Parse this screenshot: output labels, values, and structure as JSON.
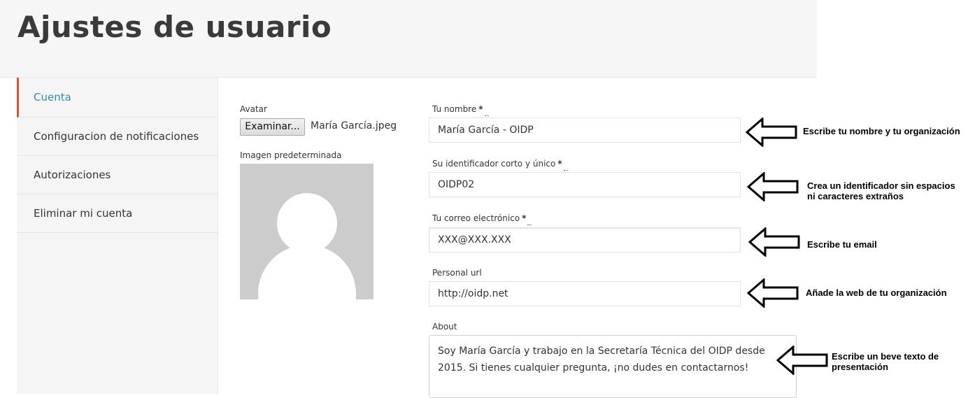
{
  "page": {
    "title": "Ajustes de usuario"
  },
  "sidebar": {
    "items": [
      {
        "label": "Cuenta",
        "active": true
      },
      {
        "label": "Configuracion de notificaciones",
        "active": false
      },
      {
        "label": "Autorizaciones",
        "active": false
      },
      {
        "label": "Eliminar mi cuenta",
        "active": false
      }
    ]
  },
  "avatar": {
    "label": "Avatar",
    "browse_button": "Examinar...",
    "file_name": "María García.jpeg",
    "default_label": "Imagen predeterminada"
  },
  "form": {
    "name": {
      "label": "Tu nombre",
      "required": "*",
      "value": "María García - OIDP"
    },
    "nickname": {
      "label": "Su identificador corto y único",
      "required": "*",
      "value": "OIDP02"
    },
    "email": {
      "label": "Tu correo electrónico",
      "required": "*",
      "value": "XXX@XXX.XXX"
    },
    "url": {
      "label": "Personal url",
      "value": "http://oidp.net"
    },
    "about": {
      "label": "About",
      "value": "Soy María García y trabajo en la Secretaría Técnica del OIDP desde 2015. Si tienes cualquier pregunta, ¡no dudes en contactarnos!"
    }
  },
  "annotations": [
    {
      "text": "Escribe tu nombre y tu organización"
    },
    {
      "line1": "Crea un identificador sin espacios",
      "line2": "ni caracteres extraños"
    },
    {
      "text": "Escribe tu email"
    },
    {
      "text": "Añade la web de tu organización"
    },
    {
      "line1": "Escribe un beve texto de",
      "line2": "presentación"
    }
  ],
  "colors": {
    "active_text": "#3a8aa6",
    "active_marker": "#d9533b"
  }
}
